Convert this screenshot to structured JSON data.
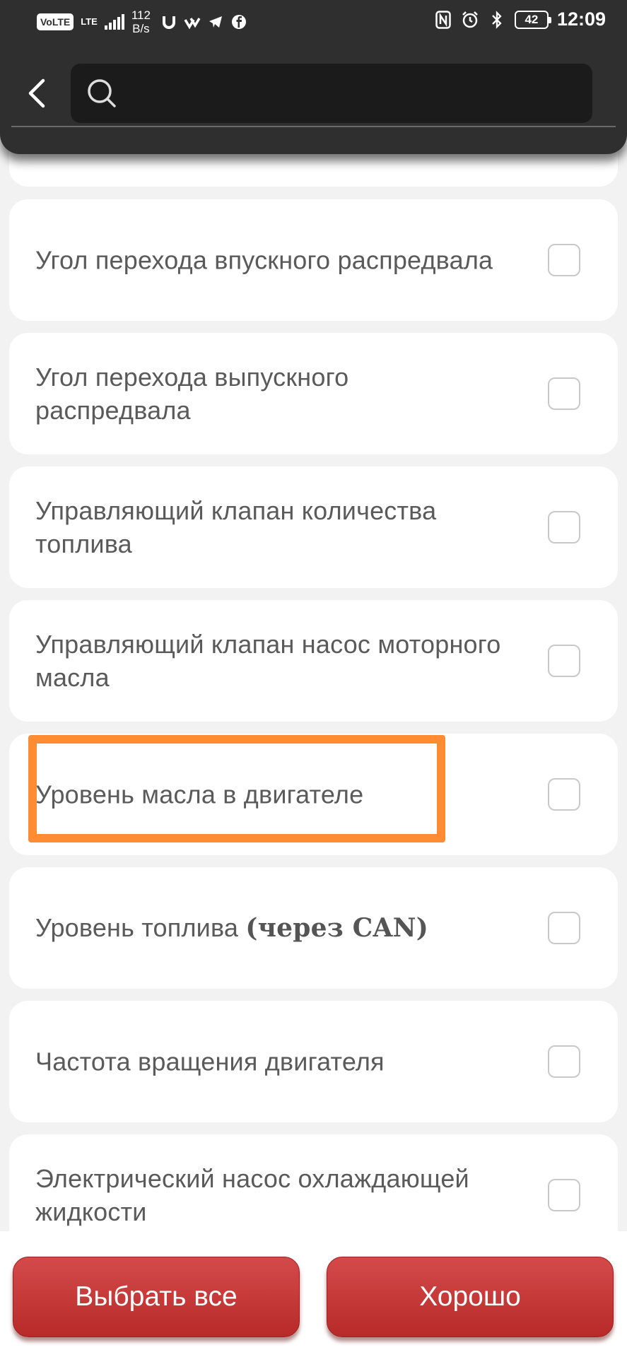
{
  "status_bar": {
    "network": "VoLTE",
    "lte": "LTE",
    "speed_value": "112",
    "speed_unit": "B/s",
    "battery": "42",
    "time": "12:09"
  },
  "header": {
    "search_placeholder": ""
  },
  "list": {
    "items": [
      {
        "label": "",
        "checked": false
      },
      {
        "label": "Угол перехода впускного распредвала",
        "checked": false
      },
      {
        "label": "Угол перехода выпускного распредвала",
        "checked": false
      },
      {
        "label": "Управляющий клапан количества топлива",
        "checked": false
      },
      {
        "label": "Управляющий клапан насос моторного масла",
        "checked": false
      },
      {
        "label": "Уровень масла в двигателе",
        "checked": false
      },
      {
        "label_text": "Уровень топлива ",
        "label_bold": "(через CAN)",
        "checked": false
      },
      {
        "label": "Частота вращения двигателя",
        "checked": false
      },
      {
        "label": "Электрический насос охлаждающей жидкости",
        "checked": false
      }
    ]
  },
  "buttons": {
    "select_all": "Выбрать все",
    "ok": "Хорошо"
  },
  "colors": {
    "header_bg": "#2f2f2f",
    "button_red": "#c43a3a",
    "highlight": "#ff8c33"
  }
}
